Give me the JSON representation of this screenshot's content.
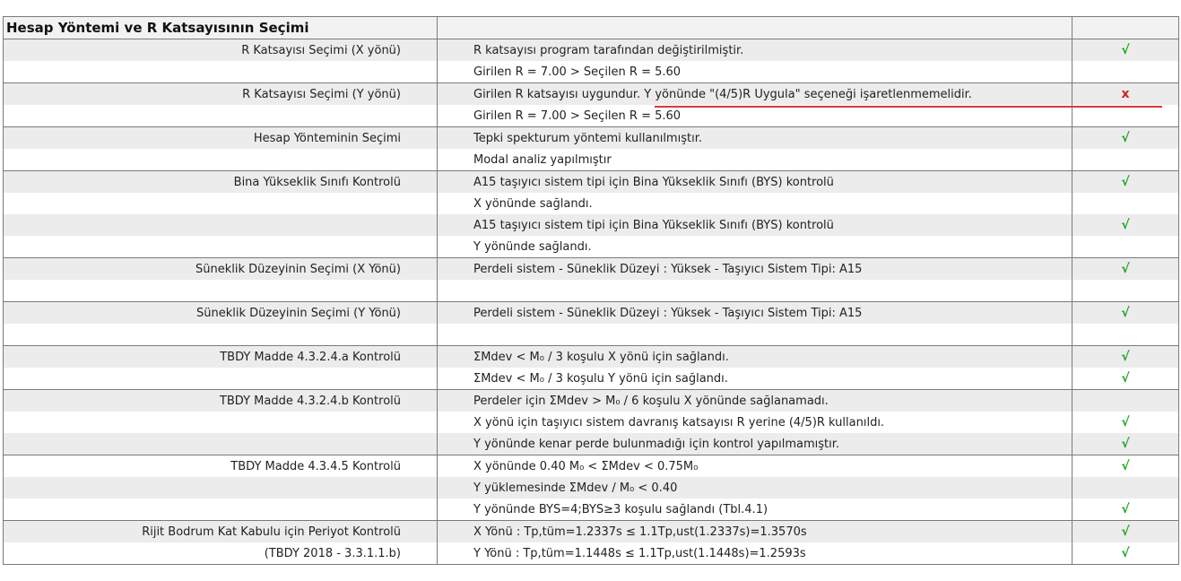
{
  "header": {
    "title": "Hesap Yöntemi ve R Katsayısının Seçimi",
    "col2": "",
    "col3": ""
  },
  "groups": [
    {
      "label": "R Katsayısı Seçimi (X yönü)",
      "rows": [
        {
          "text": "R katsayısı program tarafından değiştirilmiştir.",
          "status": "ok"
        },
        {
          "text": "Girilen R = 7.00 > Seçilen R = 5.60",
          "status": ""
        }
      ]
    },
    {
      "label": "R Katsayısı Seçimi (Y yönü)",
      "rows": [
        {
          "text": "Girilen R katsayısı uygundur. Y yönünde \"(4/5)R Uygula\" seçeneği işaretlenmemelidir.",
          "status": "fail"
        },
        {
          "text": "Girilen R = 7.00 > Seçilen R = 5.60",
          "status": ""
        }
      ]
    },
    {
      "label": "Hesap Yönteminin Seçimi",
      "rows": [
        {
          "text": "Tepki spekturum yöntemi kullanılmıştır.",
          "status": "ok"
        },
        {
          "text": "Modal analiz yapılmıştır",
          "status": ""
        }
      ]
    },
    {
      "label": "Bina Yükseklik Sınıfı Kontrolü",
      "rows": [
        {
          "text": "A15 taşıyıcı sistem tipi için Bina Yükseklik Sınıfı (BYS) kontrolü",
          "status": "ok"
        },
        {
          "text": "X yönünde sağlandı.",
          "status": ""
        },
        {
          "text": "A15 taşıyıcı sistem tipi için Bina Yükseklik Sınıfı (BYS) kontrolü",
          "status": "ok"
        },
        {
          "text": "Y yönünde sağlandı.",
          "status": ""
        }
      ]
    },
    {
      "label": "Süneklik Düzeyinin Seçimi (X Yönü)",
      "rows": [
        {
          "text": "Perdeli sistem - Süneklik Düzeyi : Yüksek - Taşıyıcı Sistem Tipi: A15",
          "status": "ok"
        },
        {
          "text": "",
          "status": ""
        }
      ]
    },
    {
      "label": "Süneklik Düzeyinin Seçimi (Y Yönü)",
      "rows": [
        {
          "text": "Perdeli sistem - Süneklik Düzeyi : Yüksek - Taşıyıcı Sistem Tipi: A15",
          "status": "ok"
        },
        {
          "text": "",
          "status": ""
        }
      ]
    },
    {
      "label": "TBDY Madde 4.3.2.4.a Kontrolü",
      "rows": [
        {
          "text": "ΣMdev < M₀ / 3 koşulu X yönü için sağlandı.",
          "status": "ok"
        },
        {
          "text": "ΣMdev < M₀ / 3 koşulu Y yönü için sağlandı.",
          "status": "ok"
        }
      ]
    },
    {
      "label": "TBDY Madde 4.3.2.4.b Kontrolü",
      "rows": [
        {
          "text": "Perdeler için ΣMdev > M₀ / 6 koşulu X yönünde sağlanamadı.",
          "status": ""
        },
        {
          "text": "X yönü için taşıyıcı sistem davranış katsayısı R yerine (4/5)R kullanıldı.",
          "status": "ok"
        },
        {
          "text": "Y yönünde kenar perde bulunmadığı için kontrol yapılmamıştır.",
          "status": "ok"
        }
      ]
    },
    {
      "label": "TBDY Madde 4.3.4.5 Kontrolü",
      "rows": [
        {
          "text": "X yönünde 0.40 M₀  < ΣMdev < 0.75M₀",
          "status": "ok"
        },
        {
          "text": "Y yüklemesinde ΣMdev / M₀  < 0.40",
          "status": ""
        },
        {
          "text": "Y yönünde BYS=4;BYS≥3 koşulu sağlandı (Tbl.4.1)",
          "status": "ok"
        }
      ]
    },
    {
      "label": "Rijit Bodrum Kat Kabulu için Periyot Kontrolü",
      "rows": [
        {
          "text": "X Yönü : Tp,tüm=1.2337s ≤ 1.1Tp,ust(1.2337s)=1.3570s",
          "status": "ok",
          "label2": ""
        },
        {
          "text": "Y Yönü : Tp,tüm=1.1448s ≤ 1.1Tp,ust(1.1448s)=1.2593s",
          "status": "ok",
          "label2": "(TBDY 2018 - 3.3.1.1.b)"
        }
      ]
    }
  ],
  "status_symbols": {
    "ok": "√",
    "fail": "x"
  },
  "colors": {
    "ok": "#1aa31a",
    "fail": "#cc2222",
    "shade": "#ececec",
    "underline": "#d93a3a"
  }
}
